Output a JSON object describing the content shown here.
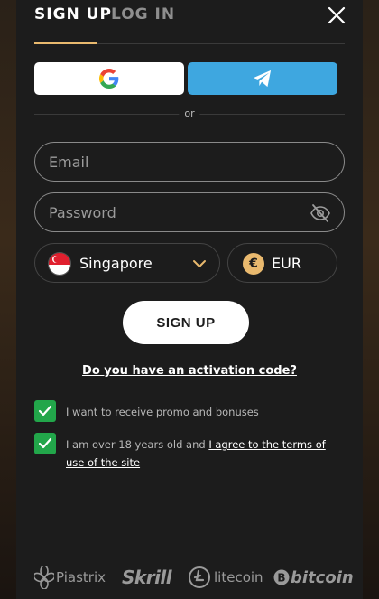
{
  "tabs": [
    {
      "label": "SIGN UP",
      "active": true
    },
    {
      "label": "LOG IN",
      "active": false
    }
  ],
  "social": {
    "google_icon": "google-icon",
    "telegram_icon": "telegram-icon"
  },
  "divider_text": "or",
  "form": {
    "email": {
      "placeholder": "Email",
      "value": ""
    },
    "password": {
      "placeholder": "Password",
      "value": ""
    },
    "country": {
      "selected": "Singapore",
      "flag": "singapore-flag"
    },
    "currency": {
      "selected": "EUR",
      "symbol": "€"
    }
  },
  "signup_button": "SIGN UP",
  "activation_link": "Do you have an activation code?",
  "checkboxes": [
    {
      "checked": true,
      "text": "I want to receive promo and bonuses"
    },
    {
      "checked": true,
      "text_prefix": "I am over 18 years old and ",
      "link": "I agree to the terms of use of the site"
    }
  ],
  "payments": [
    "Piastrix",
    "Skrill",
    "litecoin",
    "bitcoin"
  ],
  "colors": {
    "accent": "#e9b96e",
    "telegram": "#3ea7e0",
    "checkbox": "#22a64a",
    "background": "#1c1c1c"
  }
}
